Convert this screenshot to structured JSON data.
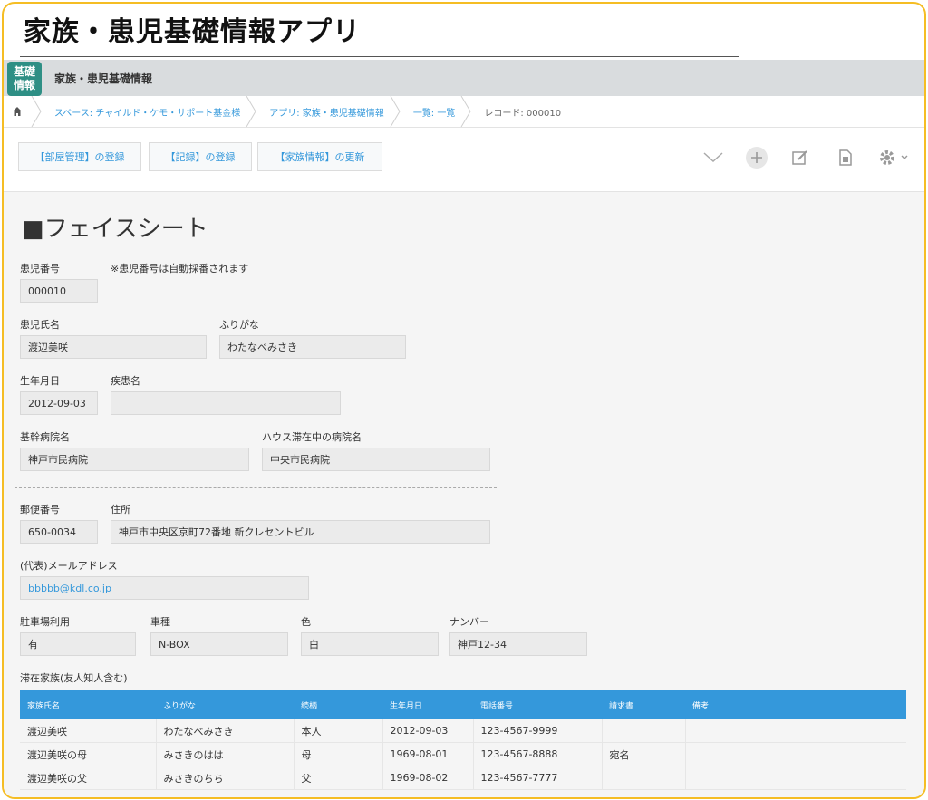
{
  "page": {
    "title": "家族・患児基礎情報アプリ"
  },
  "app": {
    "icon_text": [
      "基礎",
      "情報"
    ],
    "name": "家族・患児基礎情報"
  },
  "breadcrumb": {
    "home_icon": "home-icon",
    "items": [
      "スペース: チャイルド・ケモ・サポート基金様",
      "アプリ: 家族・患児基礎情報",
      "一覧: 一覧",
      "レコード: 000010"
    ]
  },
  "toolbar": {
    "buttons": [
      "【部屋管理】の登録",
      "【記録】の登録",
      "【家族情報】の更新"
    ],
    "icons": [
      "chevron-down-icon",
      "plus-icon",
      "edit-icon",
      "copy-icon",
      "gear-icon"
    ]
  },
  "form": {
    "section_title": "■フェイスシート",
    "patient_no": {
      "label": "患児番号",
      "value": "000010",
      "note": "※患児番号は自動採番されます"
    },
    "patient_name": {
      "label": "患児氏名",
      "value": "渡辺美咲"
    },
    "furigana": {
      "label": "ふりがな",
      "value": "わたなべみさき"
    },
    "birthdate": {
      "label": "生年月日",
      "value": "2012-09-03"
    },
    "disease": {
      "label": "疾患名",
      "value": ""
    },
    "main_hospital": {
      "label": "基幹病院名",
      "value": "神戸市民病院"
    },
    "stay_hospital": {
      "label": "ハウス滞在中の病院名",
      "value": "中央市民病院"
    },
    "postal_code": {
      "label": "郵便番号",
      "value": "650-0034"
    },
    "address": {
      "label": "住所",
      "value": "神戸市中央区京町72番地 新クレセントビル"
    },
    "email": {
      "label": "(代表)メールアドレス",
      "value": "bbbbb@kdl.co.jp"
    },
    "parking": {
      "label": "駐車場利用",
      "value": "有"
    },
    "car_model": {
      "label": "車種",
      "value": "N-BOX"
    },
    "color": {
      "label": "色",
      "value": "白"
    },
    "plate": {
      "label": "ナンバー",
      "value": "神戸12-34"
    },
    "family_table": {
      "label": "滞在家族(友人知人含む)",
      "columns": [
        "家族氏名",
        "ふりがな",
        "続柄",
        "生年月日",
        "電話番号",
        "請求書",
        "備考"
      ],
      "rows": [
        [
          "渡辺美咲",
          "わたなべみさき",
          "本人",
          "2012-09-03",
          "123-4567-9999",
          "",
          ""
        ],
        [
          "渡辺美咲の母",
          "みさきのはは",
          "母",
          "1969-08-01",
          "123-4567-8888",
          "宛名",
          ""
        ],
        [
          "渡辺美咲の父",
          "みさきのちち",
          "父",
          "1969-08-02",
          "123-4567-7777",
          "",
          ""
        ]
      ]
    }
  },
  "colors": {
    "accent": "#3498db",
    "app_icon_bg": "#2e8f85",
    "frame_border": "#f5bd24"
  }
}
